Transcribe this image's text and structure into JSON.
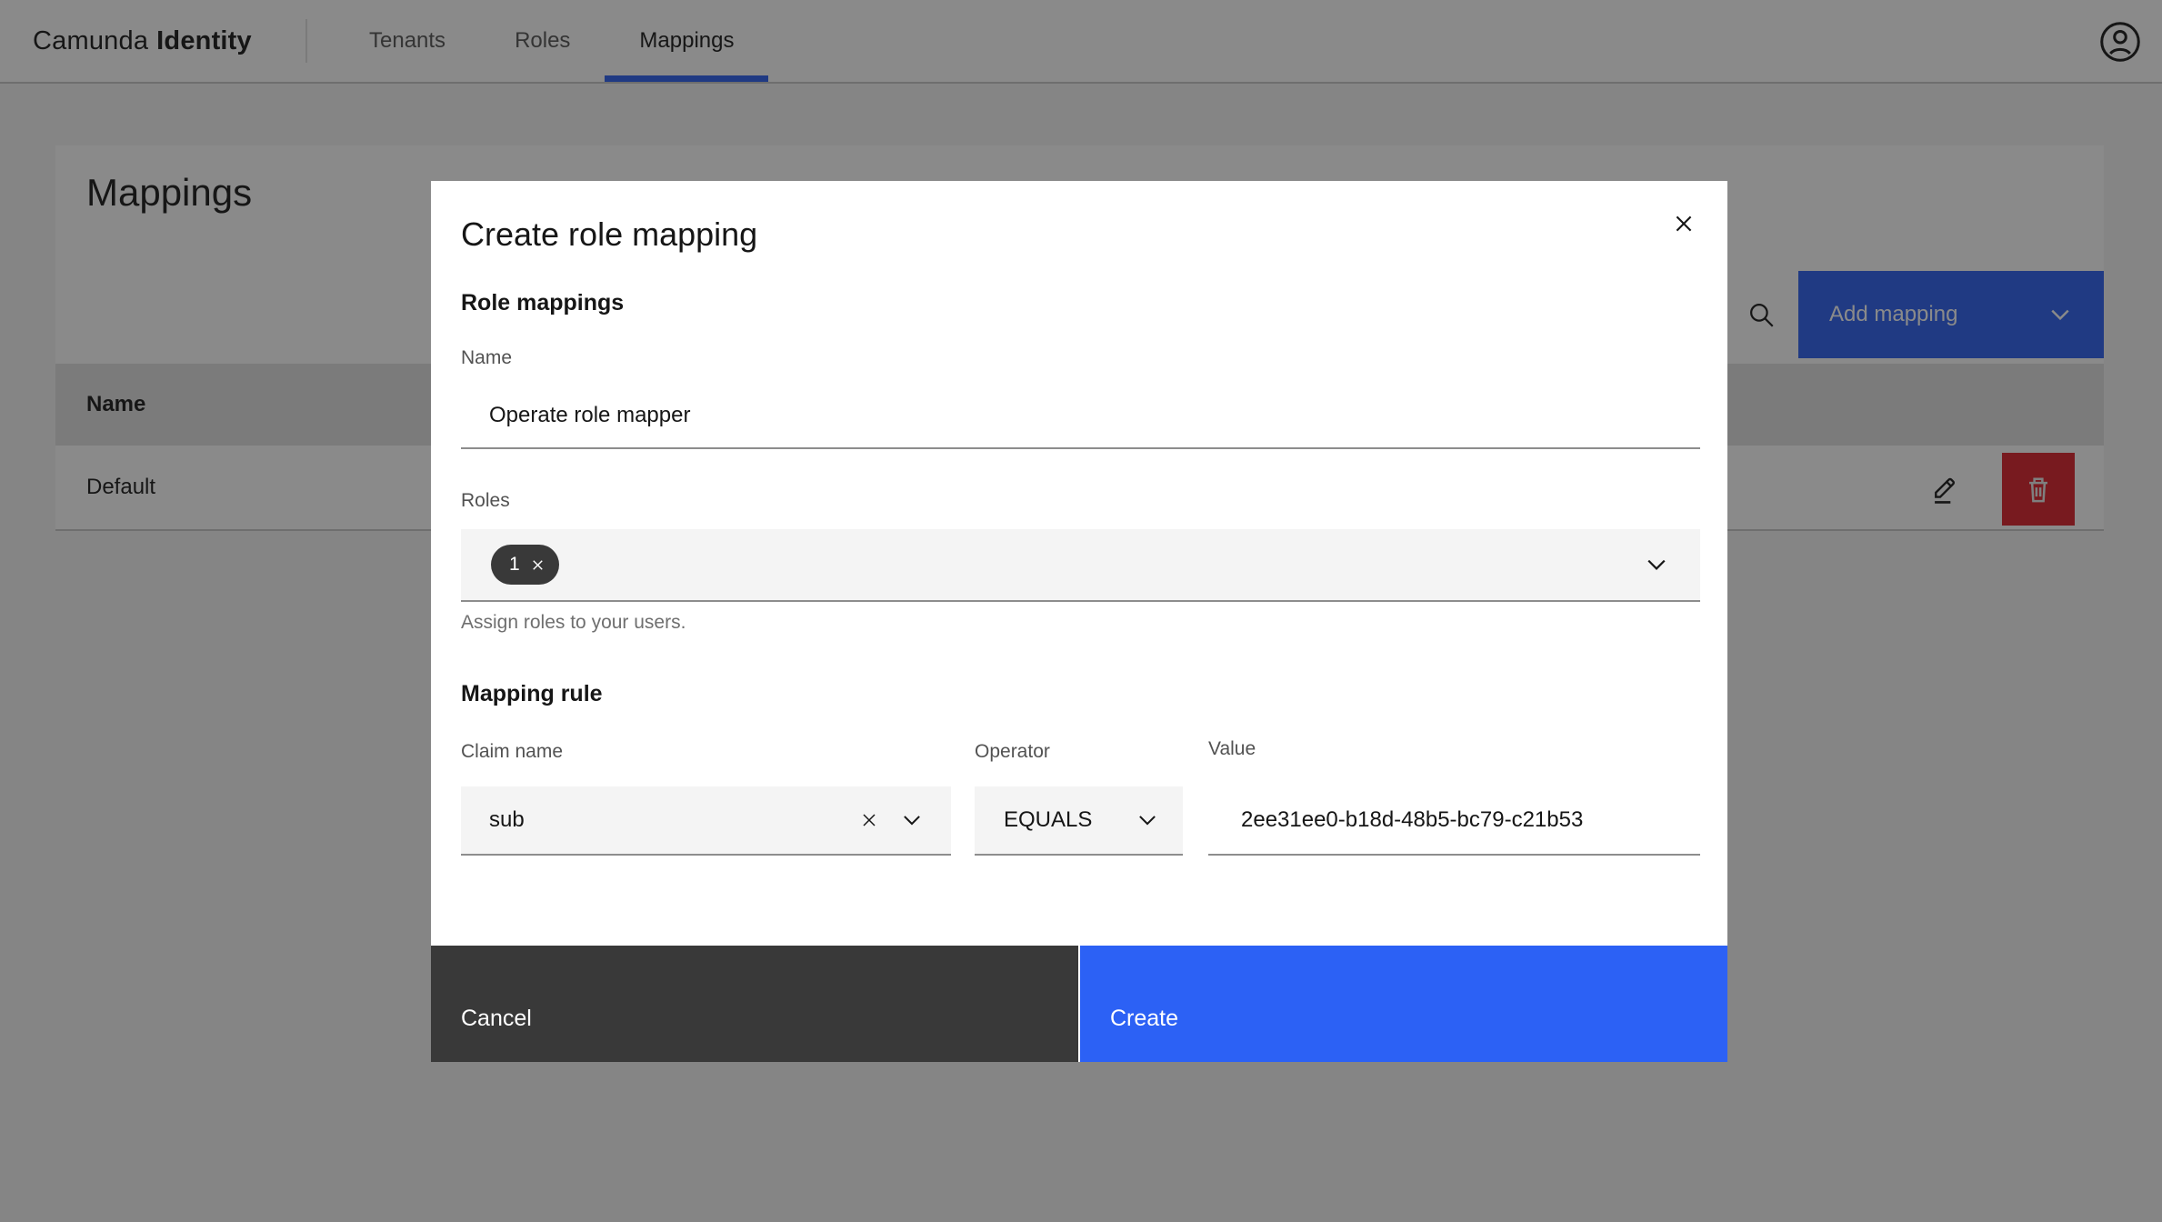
{
  "nav": {
    "brand": {
      "name": "Camunda",
      "product": "Identity"
    },
    "tabs": [
      {
        "label": "Tenants"
      },
      {
        "label": "Roles"
      },
      {
        "label": "Mappings"
      }
    ]
  },
  "page": {
    "title": "Mappings",
    "toolbar": {
      "add_button_label": "Add mapping"
    },
    "table": {
      "columns": [
        {
          "label": "Name"
        }
      ],
      "rows": [
        {
          "name": "Default"
        }
      ]
    }
  },
  "modal": {
    "title": "Create role mapping",
    "sections": {
      "role_mappings": "Role mappings",
      "mapping_rule": "Mapping rule"
    },
    "fields": {
      "name": {
        "label": "Name",
        "value": "Operate role mapper"
      },
      "roles": {
        "label": "Roles",
        "selected_count": "1",
        "helper": "Assign roles to your users."
      },
      "claim_name": {
        "label": "Claim name",
        "value": "sub"
      },
      "operator": {
        "label": "Operator",
        "value": "EQUALS"
      },
      "value": {
        "label": "Value",
        "value": "2ee31ee0-b18d-48b5-bc79-c21b53"
      }
    },
    "actions": {
      "cancel": "Cancel",
      "create": "Create"
    }
  },
  "colors": {
    "primary": "#2b5ff0",
    "secondary": "#393939",
    "danger": "#da1e28",
    "tag": "#393939",
    "field_background": "#f4f4f4",
    "border_strong": "#8d8d8d"
  }
}
